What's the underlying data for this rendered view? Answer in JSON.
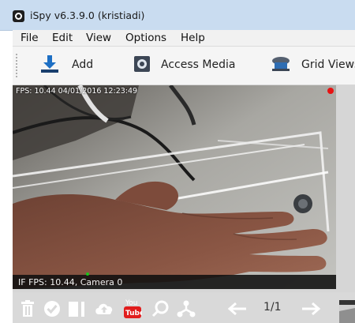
{
  "window": {
    "title": "iSpy v6.3.9.0 (kristiadi)"
  },
  "menu": {
    "items": [
      "File",
      "Edit",
      "View",
      "Options",
      "Help"
    ]
  },
  "toolbar": {
    "add_label": "Add",
    "access_media_label": "Access Media",
    "grid_views_label": "Grid Views"
  },
  "camera": {
    "overlay_top": "FPS: 10.44 04/01/2016 12:23:49",
    "footer": "IF  FPS: 10.44, Camera 0"
  },
  "bottombar": {
    "pager": "1/1"
  },
  "colors": {
    "titlebar": "#c9dcf0",
    "bottombar": "#d9d9d9",
    "recording": "#e81212",
    "motion": "#19c419"
  }
}
